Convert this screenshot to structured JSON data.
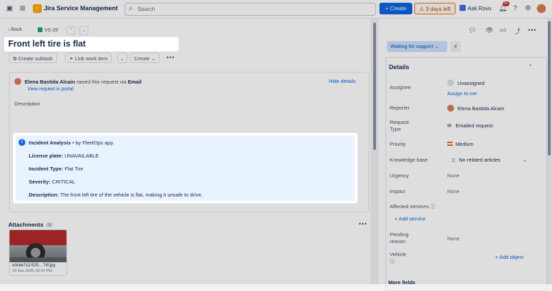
{
  "topbar": {
    "app_name": "Jira Service Management",
    "search_placeholder": "Search",
    "create_label": "+ Create",
    "trial_label": "3 days left",
    "ask_rovo_label": "Ask Rovo",
    "notifications_badge": "9+"
  },
  "issue": {
    "back_label": "Back",
    "key": "VS-29",
    "title": "Front left tire is flat",
    "actions": {
      "create_subtask": "Create subtask",
      "link_work_item": "Link work item",
      "create": "Create"
    },
    "reporter_name": "Elena Bastida Alcain",
    "raised_text": "raised this request via",
    "channel": "Email",
    "view_portal": "View request in portal",
    "hide_details": "Hide details",
    "description_label": "Description",
    "incident": {
      "title": "Incident Analysis",
      "by": "• by FleetOps app",
      "license_plate_label": "License plate:",
      "license_plate_value": "UNAVAILABLE",
      "incident_type_label": "Incident Type:",
      "incident_type_value": "Flat Tire",
      "severity_label": "Severity:",
      "severity_value": "CRITICAL",
      "description_label": "Description:",
      "description_value": "The front left tire of the vehicle is flat, making it unsafe to drive."
    },
    "attachments": {
      "title": "Attachments",
      "count": "1",
      "file_name": "e3cbe7c2-525... 74f.jpg",
      "file_date": "15 Dec 2025, 02:47 PM"
    }
  },
  "sidebar": {
    "status": "Waiting for support",
    "details_title": "Details",
    "fields": {
      "assignee_label": "Assignee",
      "assignee_value": "Unassigned",
      "assign_to_me": "Assign to me",
      "reporter_label": "Reporter",
      "reporter_value": "Elena Bastida Alcain",
      "request_type_label_1": "Request",
      "request_type_label_2": "Type",
      "request_type_value": "Emailed request",
      "priority_label": "Priority",
      "priority_value": "Medium",
      "knowledge_base_label": "Knowledge base",
      "knowledge_base_value": "No related articles",
      "urgency_label": "Urgency",
      "urgency_value": "None",
      "impact_label": "Impact",
      "impact_value": "None",
      "affected_services_label": "Affected services",
      "add_service": "Add service",
      "pending_reason_label_1": "Pending",
      "pending_reason_label_2": "reason",
      "pending_reason_value": "None",
      "vehicle_label": "Vehicle",
      "add_object": "Add object"
    },
    "more_fields": "More fields"
  }
}
